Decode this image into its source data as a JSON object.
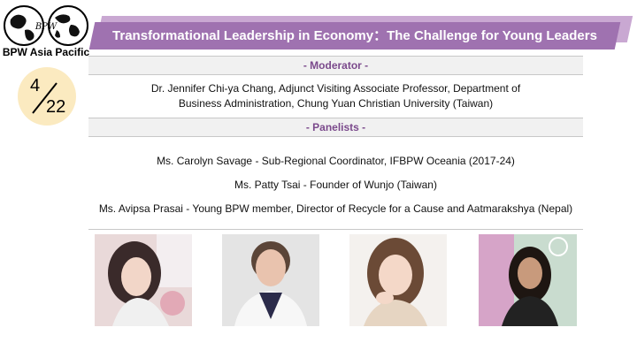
{
  "logo": {
    "caption": "BPW Asia Pacific",
    "emblem_text": "BPW"
  },
  "date_badge": {
    "month": "4",
    "day": "22",
    "color": "#fbeac0"
  },
  "title": "Transformational Leadership in Economy：The Challenge for Young Leaders",
  "colors": {
    "banner": "#9f72b0",
    "banner_shadow": "#c9a8d2",
    "section_text": "#7b4a8c"
  },
  "moderator": {
    "heading": "- Moderator -",
    "line1": "Dr. Jennifer Chi-ya Chang, Adjunct Visiting Associate Professor, Department of",
    "line2": "Business Administration, Chung Yuan Christian University (Taiwan)"
  },
  "panelists": {
    "heading": "- Panelists -",
    "items": [
      "Ms. Carolyn Savage - Sub-Regional Coordinator, IFBPW Oceania (2017-24)",
      "Ms. Patty Tsai - Founder of Wunjo (Taiwan)",
      "Ms. Avipsa Prasai - Young BPW member, Director of Recycle for a Cause and Aatmarakshya (Nepal)"
    ]
  },
  "photos": [
    {
      "icon": "portrait-photo"
    },
    {
      "icon": "portrait-photo"
    },
    {
      "icon": "portrait-photo"
    },
    {
      "icon": "portrait-photo"
    }
  ]
}
